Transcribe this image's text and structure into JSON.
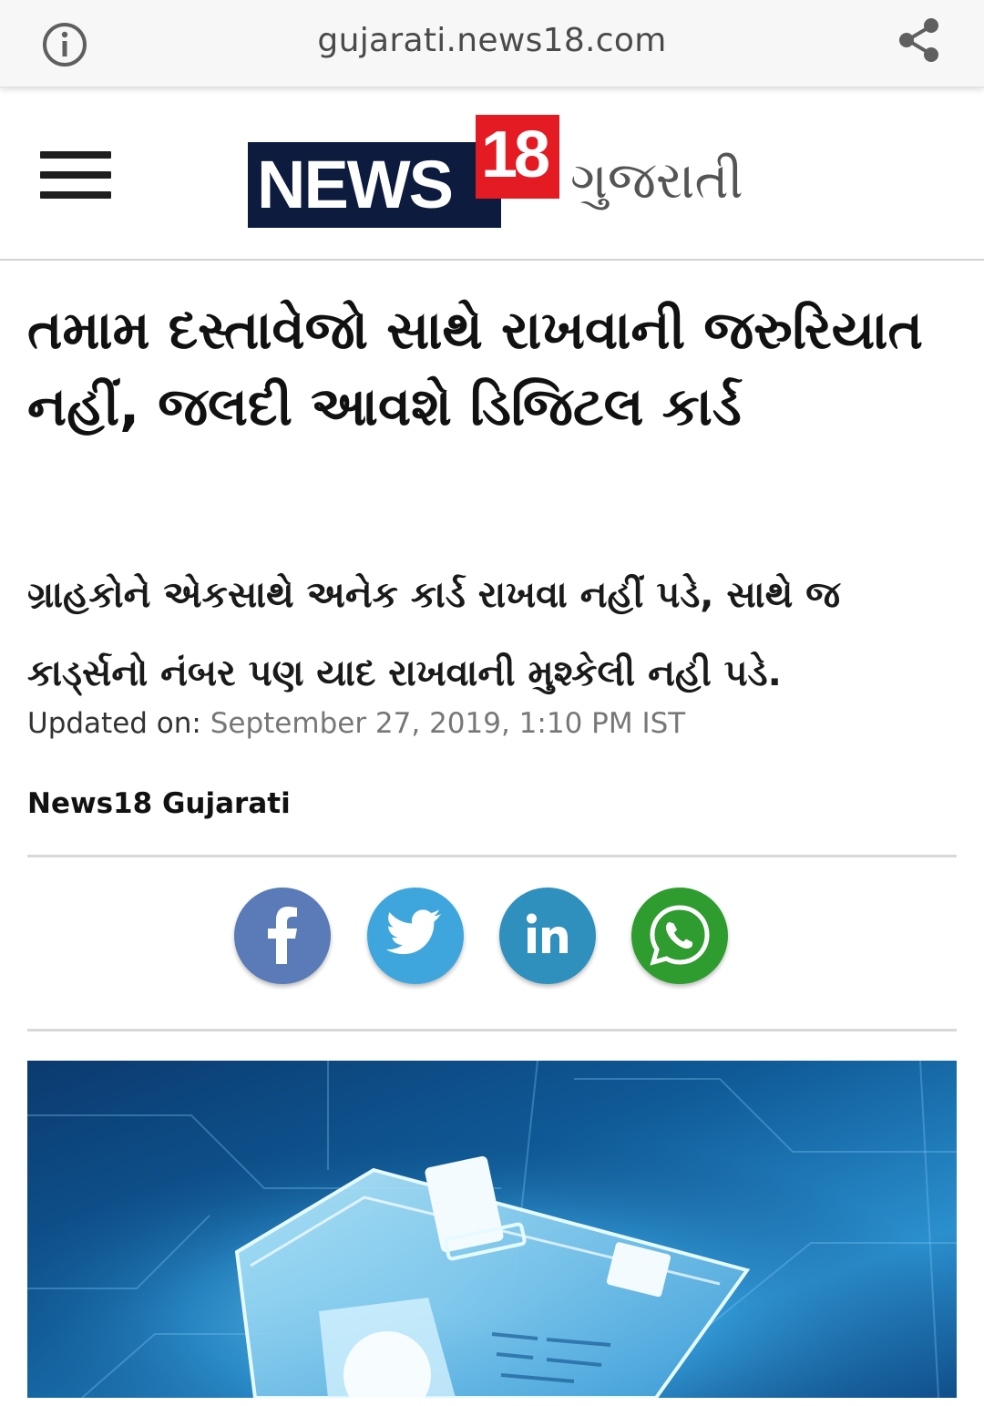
{
  "browser": {
    "url": "gujarati.news18.com",
    "info_icon": "info-icon",
    "share_icon": "share-icon"
  },
  "header": {
    "menu_icon": "hamburger-menu-icon",
    "logo": {
      "news": "NEWS",
      "number": "18",
      "language": "ગુજરાતી",
      "colors": {
        "navy": "#0d1b3e",
        "red": "#e41b23"
      }
    }
  },
  "article": {
    "headline": "તમામ દસ્તાવેજો સાથે રાખવાની જરુરિયાત નહીં, જલદી આવશે ડિજિટલ કાર્ડ",
    "subheadline": "ગ્રાહકોને એકસાથે અનેક કાર્ડ રાખવા નહીં પડે, સાથે જ કાર્ડ્સનો નંબર પણ યાદ રાખવાની મુશ્કેલી નહી પડે.",
    "updated_label": "Updated on:",
    "updated_date": "September 27, 2019, 1:10 PM IST",
    "author": "News18 Gujarati"
  },
  "share": {
    "buttons": [
      {
        "name": "facebook",
        "icon": "facebook-icon",
        "color": "#5a7ab8"
      },
      {
        "name": "twitter",
        "icon": "twitter-icon",
        "color": "#3fa6dd"
      },
      {
        "name": "linkedin",
        "icon": "linkedin-icon",
        "color": "#2f8fbd"
      },
      {
        "name": "whatsapp",
        "icon": "whatsapp-icon",
        "color": "#2e9c2e"
      }
    ]
  },
  "hero_image": {
    "subject": "digital-card-illustration"
  }
}
